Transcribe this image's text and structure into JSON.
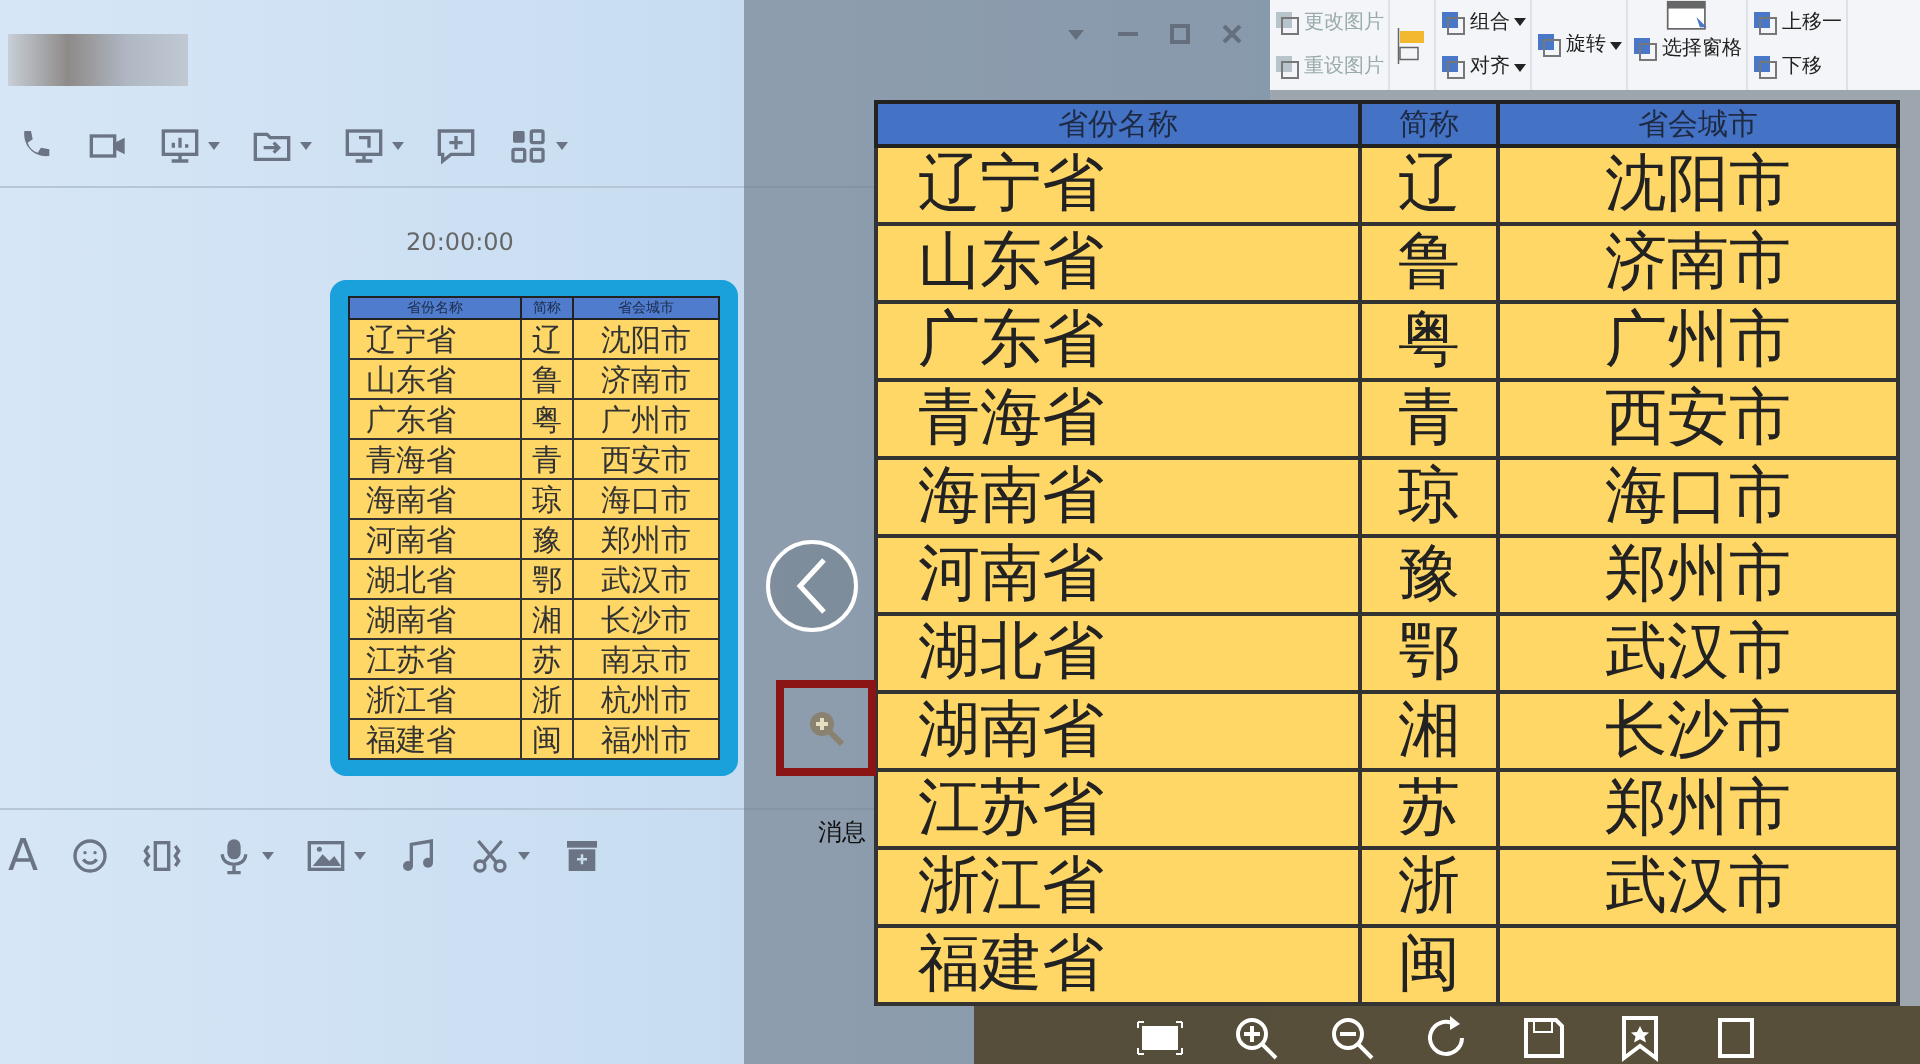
{
  "chat": {
    "time": "20:00:00",
    "font_button": "A",
    "side_label": "消息",
    "small_table": {
      "columns": [
        "省份名称",
        "简称",
        "省会城市"
      ],
      "rows": [
        [
          "辽宁省",
          "辽",
          "沈阳市"
        ],
        [
          "山东省",
          "鲁",
          "济南市"
        ],
        [
          "广东省",
          "粤",
          "广州市"
        ],
        [
          "青海省",
          "青",
          "西安市"
        ],
        [
          "海南省",
          "琼",
          "海口市"
        ],
        [
          "河南省",
          "豫",
          "郑州市"
        ],
        [
          "湖北省",
          "鄂",
          "武汉市"
        ],
        [
          "湖南省",
          "湘",
          "长沙市"
        ],
        [
          "江苏省",
          "苏",
          "南京市"
        ],
        [
          "浙江省",
          "浙",
          "杭州市"
        ],
        [
          "福建省",
          "闽",
          "福州市"
        ]
      ]
    }
  },
  "ribbon": {
    "items": [
      {
        "label": "更改图片",
        "disabled": true,
        "dropdown": false
      },
      {
        "label": "重设图片",
        "disabled": true,
        "dropdown": false
      },
      {
        "label": "组合",
        "disabled": false,
        "dropdown": true
      },
      {
        "label": "对齐",
        "disabled": false,
        "dropdown": true
      },
      {
        "label": "旋转",
        "disabled": false,
        "dropdown": true
      },
      {
        "label": "选择窗格",
        "disabled": false,
        "dropdown": false
      },
      {
        "label": "上移一",
        "disabled": false,
        "dropdown": false
      },
      {
        "label": "下移",
        "disabled": false,
        "dropdown": false
      }
    ]
  },
  "viewer": {
    "table": {
      "columns": [
        "省份名称",
        "简称",
        "省会城市"
      ],
      "rows": [
        [
          "辽宁省",
          "辽",
          "沈阳市"
        ],
        [
          "山东省",
          "鲁",
          "济南市"
        ],
        [
          "广东省",
          "粤",
          "广州市"
        ],
        [
          "青海省",
          "青",
          "西安市"
        ],
        [
          "海南省",
          "琼",
          "海口市"
        ],
        [
          "河南省",
          "豫",
          "郑州市"
        ],
        [
          "湖北省",
          "鄂",
          "武汉市"
        ],
        [
          "湖南省",
          "湘",
          "长沙市"
        ],
        [
          "江苏省",
          "苏",
          "郑州市"
        ],
        [
          "浙江省",
          "浙",
          "武汉市"
        ],
        [
          "福建省",
          "闽"
        ]
      ]
    }
  }
}
